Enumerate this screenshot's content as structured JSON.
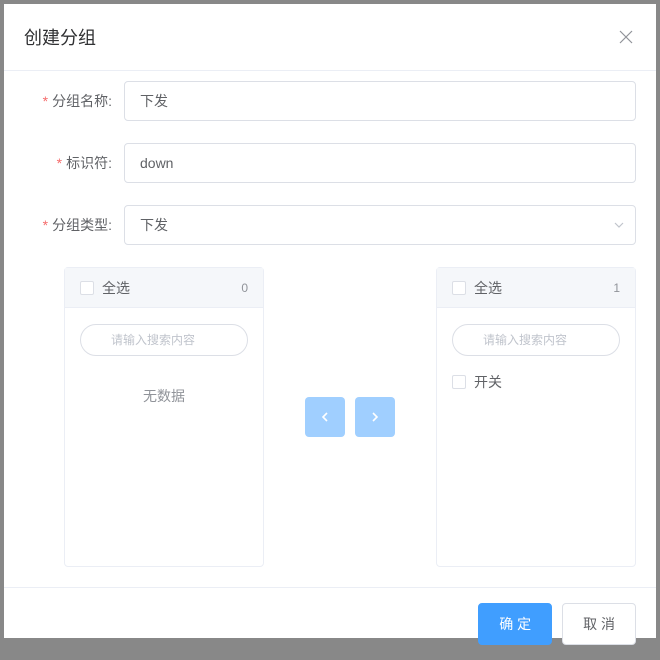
{
  "dialog": {
    "title": "创建分组"
  },
  "form": {
    "groupName": {
      "label": "分组名称:",
      "value": "下发"
    },
    "identifier": {
      "label": "标识符:",
      "value": "down"
    },
    "groupType": {
      "label": "分组类型:",
      "value": "下发"
    }
  },
  "transfer": {
    "left": {
      "selectAll": "全选",
      "count": "0",
      "searchPlaceholder": "请输入搜索内容",
      "empty": "无数据",
      "items": []
    },
    "right": {
      "selectAll": "全选",
      "count": "1",
      "searchPlaceholder": "请输入搜索内容",
      "items": [
        {
          "label": "开关"
        }
      ]
    }
  },
  "footer": {
    "confirm": "确 定",
    "cancel": "取 消"
  }
}
